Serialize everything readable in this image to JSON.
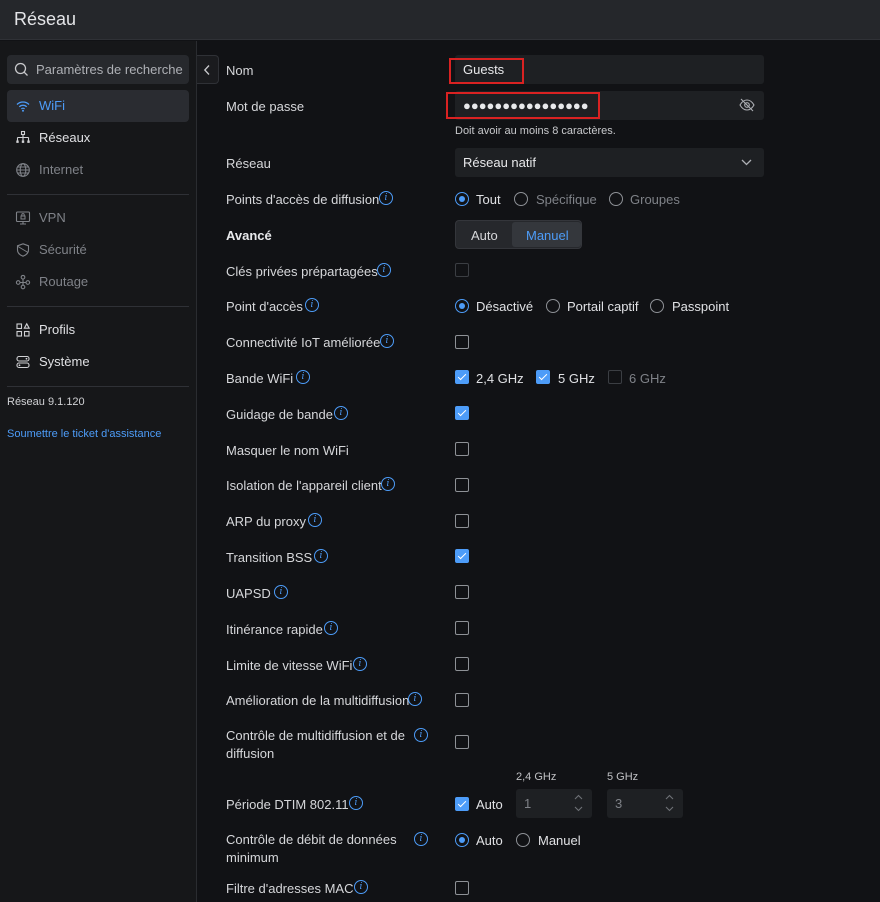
{
  "header": {
    "title": "Réseau"
  },
  "sidebar": {
    "search_placeholder": "Paramètres de recherche",
    "items": [
      {
        "label": "WiFi",
        "icon": "wifi-icon",
        "state": "active"
      },
      {
        "label": "Réseaux",
        "icon": "network-topology-icon",
        "state": "bright"
      },
      {
        "label": "Internet",
        "icon": "globe-icon",
        "state": "dim"
      },
      {
        "label": "VPN",
        "icon": "vpn-monitor-icon",
        "state": "dim"
      },
      {
        "label": "Sécurité",
        "icon": "shield-icon",
        "state": "dim"
      },
      {
        "label": "Routage",
        "icon": "routing-icon",
        "state": "dim"
      },
      {
        "label": "Profils",
        "icon": "profiles-grid-icon",
        "state": "bright"
      },
      {
        "label": "Système",
        "icon": "server-icon",
        "state": "bright"
      }
    ],
    "version": "Réseau 9.1.120",
    "ticket_link": "Soumettre le ticket d'assistance"
  },
  "form": {
    "name_label": "Nom",
    "name_value": "Guests",
    "password_label": "Mot de passe",
    "password_value": "●●●●●●●●●●●●●●●●",
    "password_hint": "Doit avoir au moins 8 caractères.",
    "network_label": "Réseau",
    "network_value": "Réseau natif",
    "broadcast_label": "Points d'accès de diffusion",
    "broadcast_options": [
      "Tout",
      "Spécifique",
      "Groupes"
    ],
    "advanced_label": "Avancé",
    "advanced_options": [
      "Auto",
      "Manuel"
    ],
    "advanced_selected": "Manuel",
    "psk_label": "Clés privées prépartagées",
    "hotspot_label": "Point d'accès",
    "hotspot_options": [
      "Désactivé",
      "Portail captif",
      "Passpoint"
    ],
    "iot_label": "Connectivité IoT améliorée",
    "band_label": "Bande WiFi",
    "bands": [
      "2,4 GHz",
      "5 GHz",
      "6 GHz"
    ],
    "band_steering_label": "Guidage de bande",
    "hide_name_label": "Masquer le nom WiFi",
    "client_isolation_label": "Isolation de l'appareil client",
    "proxy_arp_label": "ARP du proxy",
    "bss_label": "Transition BSS",
    "uapsd_label": "UAPSD",
    "fast_roaming_label": "Itinérance rapide",
    "rate_limit_label": "Limite de vitesse WiFi",
    "multicast_enh_label": "Amélioration de la multidiffusion",
    "multicast_ctrl_label": "Contrôle de multidiffusion et de diffusion",
    "dtim_label": "Période DTIM 802.11",
    "dtim_auto": "Auto",
    "dtim_24_label": "2,4 GHz",
    "dtim_5_label": "5 GHz",
    "dtim_24_value": "1",
    "dtim_5_value": "3",
    "min_rate_label": "Contrôle de débit de données minimum",
    "min_rate_options": [
      "Auto",
      "Manuel"
    ],
    "mac_filter_label": "Filtre d'adresses MAC"
  },
  "colors": {
    "accent": "#4d9cf8",
    "highlight": "#d92222"
  }
}
